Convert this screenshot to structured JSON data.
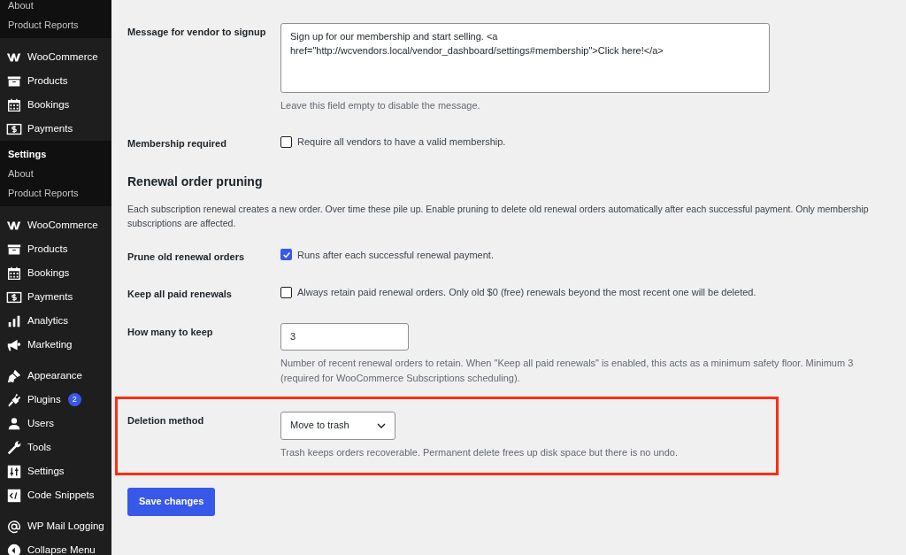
{
  "sidebar": {
    "sections": [
      {
        "kind": "submenu",
        "items": [
          {
            "label": "About",
            "selected": false
          },
          {
            "label": "Product Reports",
            "selected": false
          }
        ]
      },
      {
        "kind": "menu",
        "groups": [
          [
            {
              "label": "WooCommerce",
              "kind": "woo"
            },
            {
              "label": "Products",
              "kind": "archive"
            },
            {
              "label": "Bookings",
              "kind": "calendar"
            },
            {
              "label": "Payments",
              "kind": "money"
            }
          ]
        ]
      },
      {
        "kind": "submenu",
        "items": [
          {
            "label": "Settings",
            "selected": true
          },
          {
            "label": "About",
            "selected": false
          },
          {
            "label": "Product Reports",
            "selected": false
          }
        ]
      },
      {
        "kind": "menu",
        "groups": [
          [
            {
              "label": "WooCommerce",
              "kind": "woo"
            },
            {
              "label": "Products",
              "kind": "archive"
            },
            {
              "label": "Bookings",
              "kind": "calendar"
            },
            {
              "label": "Payments",
              "kind": "money"
            },
            {
              "label": "Analytics",
              "kind": "bars"
            },
            {
              "label": "Marketing",
              "kind": "megaphone"
            }
          ],
          [
            {
              "label": "Appearance",
              "kind": "brush"
            },
            {
              "label": "Plugins",
              "kind": "plug",
              "badge": "2"
            },
            {
              "label": "Users",
              "kind": "user"
            },
            {
              "label": "Tools",
              "kind": "wrench"
            },
            {
              "label": "Settings",
              "kind": "sliders"
            },
            {
              "label": "Code Snippets",
              "kind": "code"
            }
          ],
          [
            {
              "label": "WP Mail Logging",
              "kind": "at"
            },
            {
              "label": "Collapse Menu",
              "kind": "collapse"
            }
          ]
        ]
      }
    ]
  },
  "form": {
    "rows": [
      {
        "kind": "textarea",
        "label": "Message for vendor to signup",
        "value": "Sign up for our membership and start selling. <a href=\"http://wcvendors.local/vendor_dashboard/settings#membership\">Click here!</a>",
        "description": "Leave this field empty to disable the message.",
        "highlighted": false
      },
      {
        "kind": "checkbox",
        "label": "Membership required",
        "checked": false,
        "text": "Require all vendors to have a valid membership.",
        "highlighted": false
      },
      {
        "kind": "heading",
        "title": "Renewal order pruning",
        "description": "Each subscription renewal creates a new order. Over time these pile up. Enable pruning to delete old renewal orders automatically after each successful payment. Only membership subscriptions are affected."
      },
      {
        "kind": "checkbox",
        "label": "Prune old renewal orders",
        "checked": true,
        "text": "Runs after each successful renewal payment.",
        "highlighted": false
      },
      {
        "kind": "checkbox",
        "label": "Keep all paid renewals",
        "checked": false,
        "text": "Always retain paid renewal orders. Only old $0 (free) renewals beyond the most recent one will be deleted.",
        "highlighted": false
      },
      {
        "kind": "input",
        "label": "How many to keep",
        "value": "3",
        "description": "Number of recent renewal orders to retain. When \"Keep all paid renewals\" is enabled, this acts as a minimum safety floor. Minimum 3 (required for WooCommerce Subscriptions scheduling).",
        "highlighted": false
      },
      {
        "kind": "select",
        "label": "Deletion method",
        "value": "Move to trash",
        "description": "Trash keeps orders recoverable. Permanent delete frees up disk space but there is no undo.",
        "highlighted": true
      }
    ],
    "submit": "Save changes"
  }
}
